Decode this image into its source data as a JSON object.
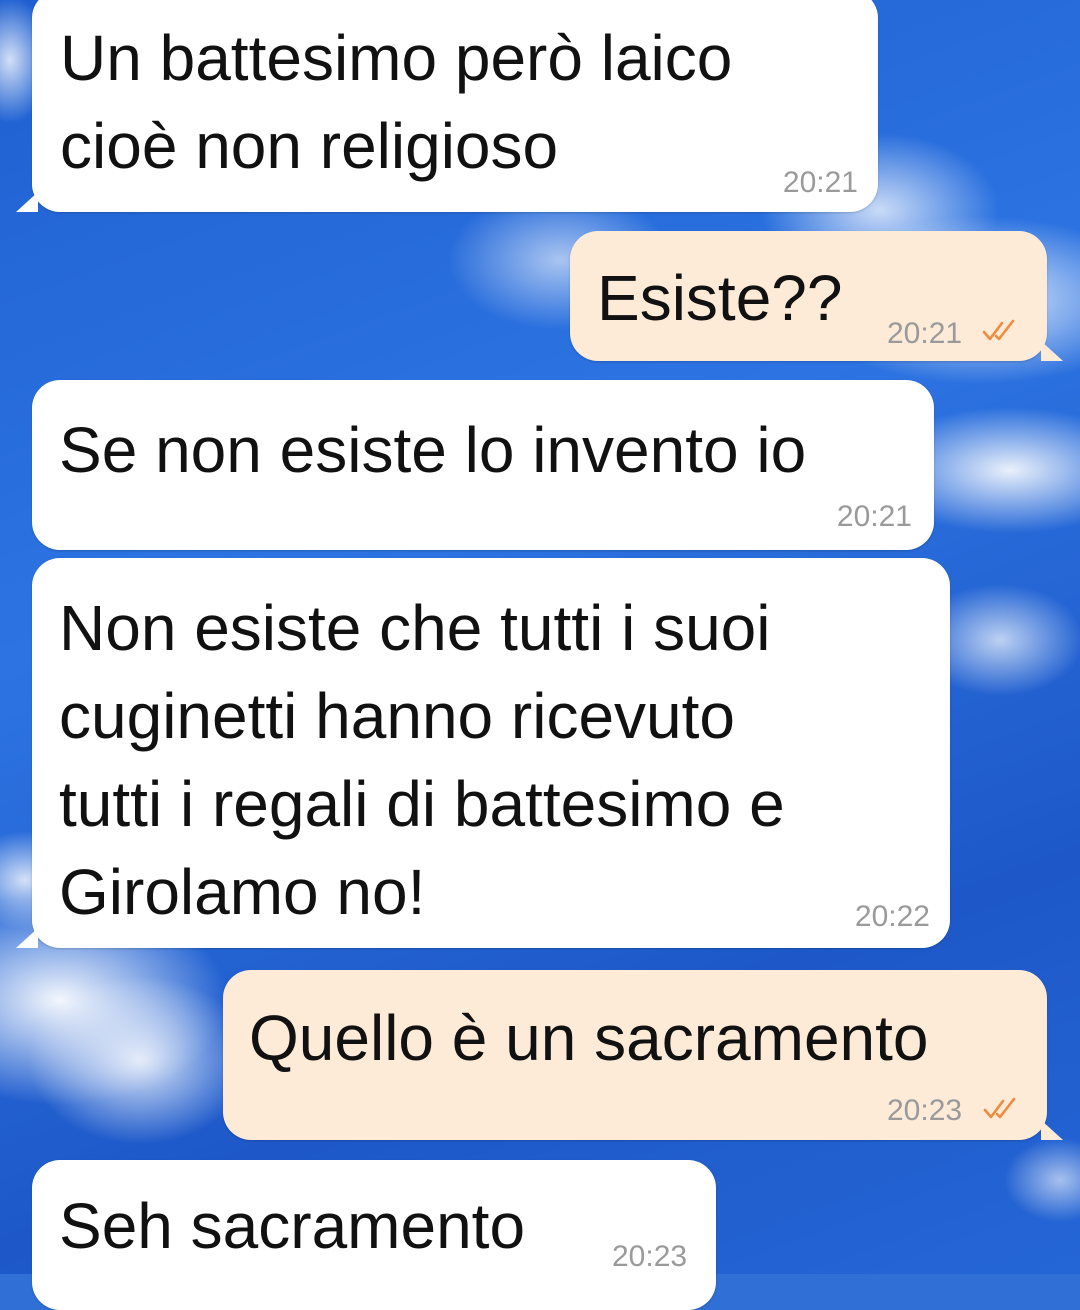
{
  "chat": {
    "wallpaper_icon": "sky-clouds-wallpaper",
    "colors": {
      "incoming_bubble": "#ffffff",
      "outgoing_bubble": "#fdebd8",
      "tick": "#f08a3c",
      "timestamp": "#9a9a9a"
    },
    "messages": [
      {
        "direction": "incoming",
        "text": "Un battesimo però laico\ncioè non religioso",
        "time": "20:21"
      },
      {
        "direction": "outgoing",
        "text": "Esiste??",
        "time": "20:21",
        "status_icon": "double-check-icon"
      },
      {
        "direction": "incoming",
        "text": "Se non esiste lo invento io",
        "time": "20:21"
      },
      {
        "direction": "incoming",
        "text": "Non esiste che tutti i suoi\ncuginetti hanno ricevuto\ntutti i regali di battesimo e\nGirolamo no!",
        "time": "20:22"
      },
      {
        "direction": "outgoing",
        "text": "Quello è un sacramento",
        "time": "20:23",
        "status_icon": "double-check-icon"
      },
      {
        "direction": "incoming",
        "text": "Seh sacramento",
        "time": "20:23"
      }
    ]
  }
}
